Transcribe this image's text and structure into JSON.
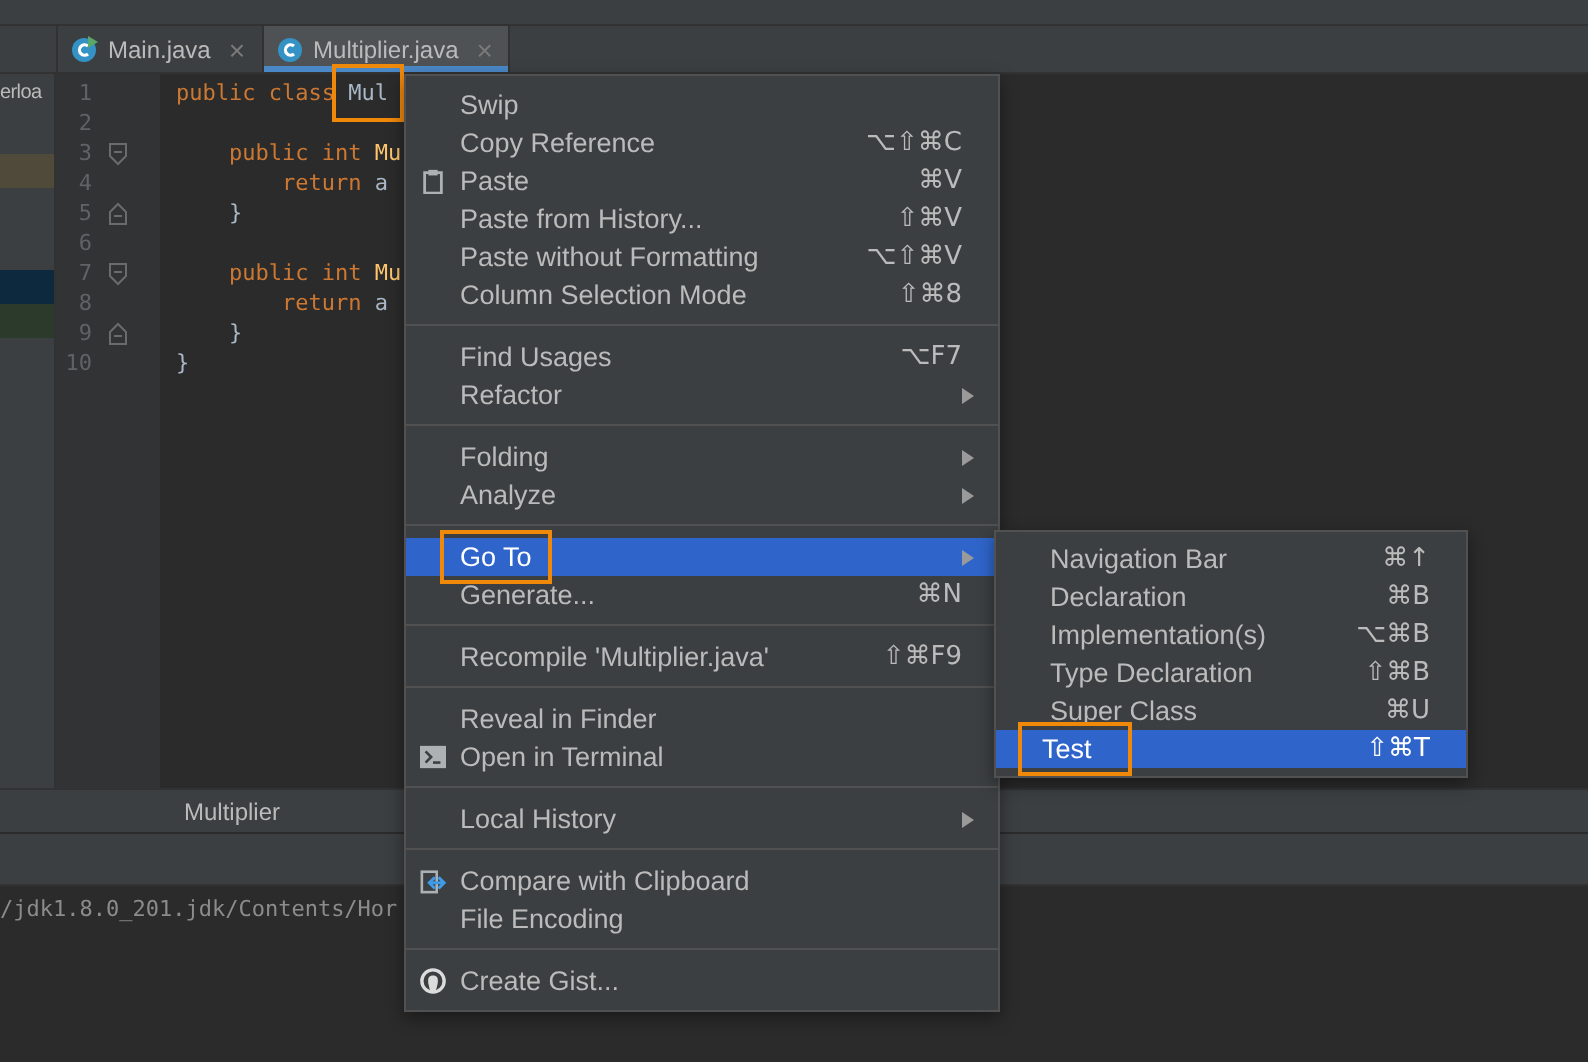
{
  "left_panel": {
    "label": "erloa"
  },
  "tabs": [
    {
      "label": "Main.java",
      "close": "×",
      "selected": false,
      "runnable": true
    },
    {
      "label": "Multiplier.java",
      "close": "×",
      "selected": true,
      "runnable": false
    }
  ],
  "code_lines": [
    {
      "number": "1",
      "kind": "top",
      "fold_open": false,
      "fold_close": false,
      "tokens": [
        {
          "kind": "keyword",
          "text": "public"
        },
        {
          "kind": "keyword",
          "text": "class"
        },
        {
          "kind": "ident",
          "text": "Mul",
          "highlighted": true
        }
      ]
    },
    {
      "number": "2",
      "kind": "top",
      "fold_open": false,
      "fold_close": false
    },
    {
      "number": "3",
      "kind": "member",
      "fold_open": true,
      "fold_close": false,
      "tokens": [
        {
          "kind": "keyword",
          "text": "public"
        },
        {
          "kind": "keyword",
          "text": "int"
        },
        {
          "kind": "method",
          "text": "Mu"
        }
      ]
    },
    {
      "number": "4",
      "kind": "statement",
      "fold_open": false,
      "fold_close": false,
      "tokens": [
        {
          "kind": "keyword",
          "text": "return"
        },
        {
          "kind": "plain",
          "text": "a"
        }
      ]
    },
    {
      "number": "5",
      "kind": "member",
      "fold_open": false,
      "fold_close": true,
      "tokens": [
        {
          "kind": "plain",
          "text": "}"
        }
      ]
    },
    {
      "number": "6",
      "kind": "top",
      "fold_open": false,
      "fold_close": false
    },
    {
      "number": "7",
      "kind": "member",
      "fold_open": true,
      "fold_close": false,
      "tokens": [
        {
          "kind": "keyword",
          "text": "public"
        },
        {
          "kind": "keyword",
          "text": "int"
        },
        {
          "kind": "method",
          "text": "Mu"
        }
      ]
    },
    {
      "number": "8",
      "kind": "statement",
      "fold_open": false,
      "fold_close": false,
      "tokens": [
        {
          "kind": "keyword",
          "text": "return"
        },
        {
          "kind": "plain",
          "text": "a"
        }
      ]
    },
    {
      "number": "9",
      "kind": "member",
      "fold_open": false,
      "fold_close": true,
      "tokens": [
        {
          "kind": "plain",
          "text": "}"
        }
      ]
    },
    {
      "number": "10",
      "kind": "top",
      "fold_open": false,
      "fold_close": false,
      "tokens": [
        {
          "kind": "plain",
          "text": "}"
        }
      ]
    }
  ],
  "breadcrumb": "Multiplier",
  "console_line": "/jdk1.8.0_201.jdk/Contents/Hor",
  "context_menu": [
    [
      {
        "label": "Swip"
      },
      {
        "label": "Copy Reference",
        "shortcut": "⌥⇧⌘C"
      },
      {
        "label": "Paste",
        "shortcut": "⌘V",
        "kind": "clipboard"
      },
      {
        "label": "Paste from History...",
        "shortcut": "⇧⌘V"
      },
      {
        "label": "Paste without Formatting",
        "shortcut": "⌥⇧⌘V"
      },
      {
        "label": "Column Selection Mode",
        "shortcut": "⇧⌘8"
      }
    ],
    [
      {
        "label": "Find Usages",
        "shortcut": "⌥F7"
      },
      {
        "label": "Refactor",
        "submenu": true
      }
    ],
    [
      {
        "label": "Folding",
        "submenu": true
      },
      {
        "label": "Analyze",
        "submenu": true
      }
    ],
    [
      {
        "label": "Go To",
        "submenu": true,
        "selected": true,
        "highlighted": true
      },
      {
        "label": "Generate...",
        "shortcut": "⌘N"
      }
    ],
    [
      {
        "label": "Recompile 'Multiplier.java'",
        "shortcut": "⇧⌘F9"
      }
    ],
    [
      {
        "label": "Reveal in Finder"
      },
      {
        "label": "Open in Terminal",
        "kind": "terminal"
      }
    ],
    [
      {
        "label": "Local History",
        "submenu": true
      }
    ],
    [
      {
        "label": "Compare with Clipboard",
        "kind": "compare"
      },
      {
        "label": "File Encoding"
      }
    ],
    [
      {
        "label": "Create Gist...",
        "kind": "github"
      }
    ]
  ],
  "submenu": [
    {
      "label": "Navigation Bar",
      "shortcut": "⌘↑",
      "selected": false
    },
    {
      "label": "Declaration",
      "shortcut": "⌘B",
      "selected": false
    },
    {
      "label": "Implementation(s)",
      "shortcut": "⌥⌘B",
      "selected": false
    },
    {
      "label": "Type Declaration",
      "shortcut": "⇧⌘B",
      "selected": false
    },
    {
      "label": "Super Class",
      "shortcut": "⌘U",
      "selected": false
    },
    {
      "label": "Test",
      "shortcut": "⇧⌘T",
      "selected": true,
      "highlighted": true
    }
  ]
}
